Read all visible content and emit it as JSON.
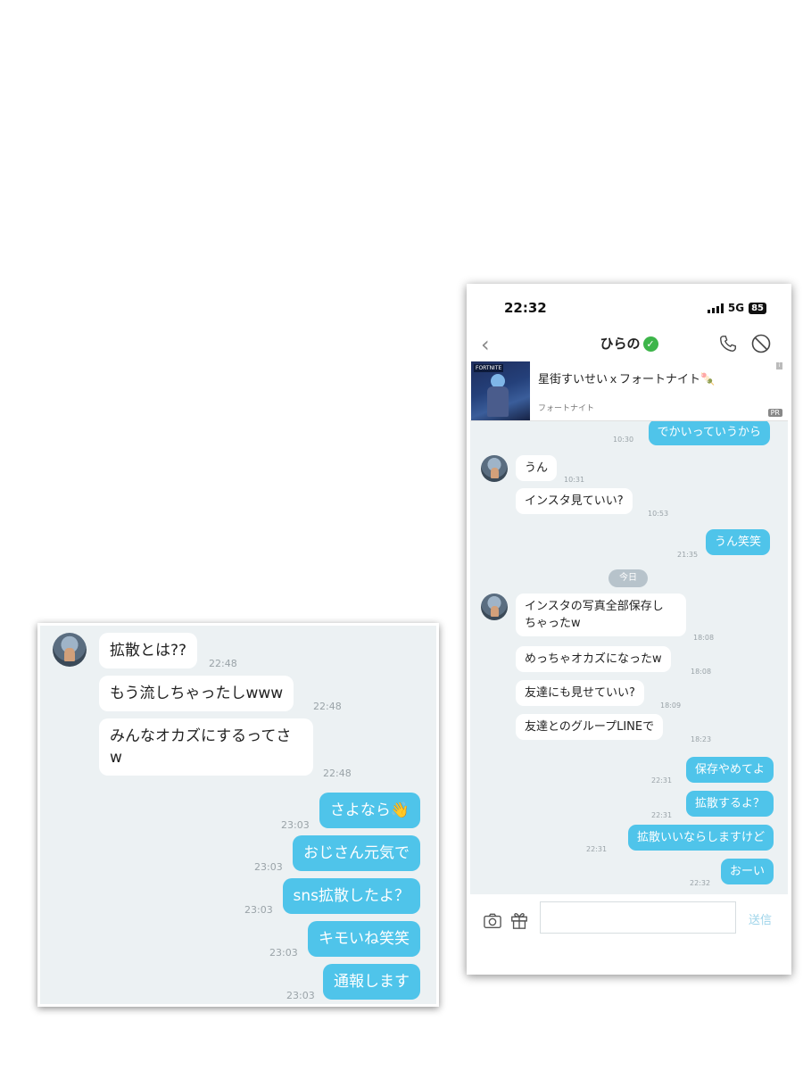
{
  "left_panel": {
    "messages": [
      {
        "dir": "in",
        "text": "拡散とは??",
        "time": "22:48"
      },
      {
        "dir": "in",
        "text": "もう流しちゃったしwww",
        "time": "22:48"
      },
      {
        "dir": "in",
        "lines": [
          "みんなオカズにするってさ",
          "w"
        ],
        "time": "22:48"
      },
      {
        "dir": "out",
        "text": "さよなら👋",
        "time": "23:03"
      },
      {
        "dir": "out",
        "text": "おじさん元気で",
        "time": "23:03"
      },
      {
        "dir": "out",
        "text": "sns拡散したよ？",
        "time": "23:03"
      },
      {
        "dir": "out",
        "text": "キモいね笑笑",
        "time": "23:03"
      },
      {
        "dir": "out",
        "text": "通報します",
        "time": "23:03"
      }
    ]
  },
  "phone": {
    "status": {
      "time": "22:32",
      "network": "5G",
      "battery": "85"
    },
    "header": {
      "back_icon": "chevron-left-icon",
      "title": "ひらの",
      "verified_icon": "check-circle-icon",
      "verified_glyph": "✓",
      "back_glyph": "‹"
    },
    "ad": {
      "title": "星街すいせいｘフォートナイト🍡",
      "advertiser": "フォートナイト",
      "badge": "PR",
      "info": "i",
      "thumb_brand": "FORTNITE"
    },
    "date_divider": "今日",
    "messages": [
      {
        "dir": "out",
        "text": "でかいっていうから",
        "time": "10:30"
      },
      {
        "dir": "in",
        "text": "うん",
        "time": "10:31"
      },
      {
        "dir": "in",
        "text": "インスタ見ていい?",
        "time": "10:53"
      },
      {
        "dir": "out",
        "text": "うん笑笑",
        "time": "21:35"
      },
      {
        "dir": "in",
        "lines": [
          "インスタの写真全部保存し",
          "ちゃったw"
        ],
        "time": "18:08"
      },
      {
        "dir": "in",
        "text": "めっちゃオカズになったw",
        "time": "18:08"
      },
      {
        "dir": "in",
        "text": "友達にも見せていい?",
        "time": "18:09"
      },
      {
        "dir": "in",
        "text": "友達とのグループLINEで",
        "time": "18:23"
      },
      {
        "dir": "out",
        "text": "保存やめてよ",
        "time": "22:31"
      },
      {
        "dir": "out",
        "text": "拡散するよ？",
        "time": "22:31"
      },
      {
        "dir": "out",
        "text": "拡散いいならしますけど",
        "time": "22:31"
      },
      {
        "dir": "out",
        "text": "おーい",
        "time": "22:32"
      }
    ],
    "input": {
      "placeholder": "",
      "send_label": "送信",
      "camera_icon": "camera-icon",
      "gift_icon": "gift-icon"
    },
    "icons": {
      "call": "phone-icon",
      "block": "block-icon"
    },
    "colors": {
      "outgoing_bubble": "#4fc4ea",
      "chat_background": "#ecf1f3",
      "verified": "#3db54a"
    }
  }
}
